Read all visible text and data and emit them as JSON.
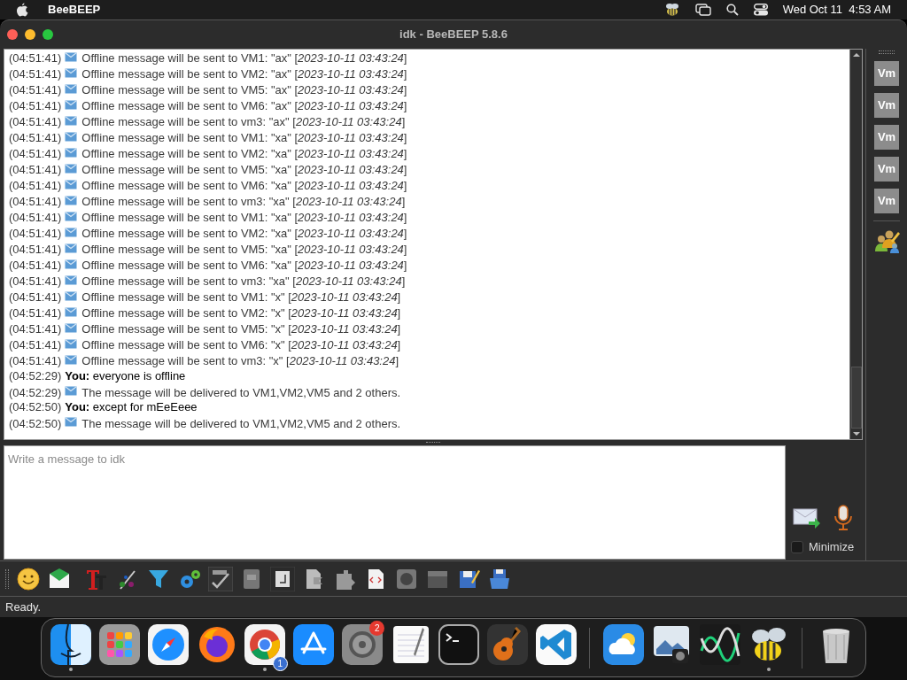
{
  "menu_bar": {
    "app_name": "BeeBEEP",
    "clock": "Wed Oct 11  4:53 AM"
  },
  "window": {
    "title": "idk - BeeBEEP 5.8.6"
  },
  "messages": [
    {
      "kind": "offline",
      "time": "(04:51:41)",
      "text": "Offline message will be sent to VM1: \"ax\" [*2023-10-11 03:43:24*]"
    },
    {
      "kind": "offline",
      "time": "(04:51:41)",
      "text": "Offline message will be sent to VM2: \"ax\" [*2023-10-11 03:43:24*]"
    },
    {
      "kind": "offline",
      "time": "(04:51:41)",
      "text": "Offline message will be sent to VM5: \"ax\" [*2023-10-11 03:43:24*]"
    },
    {
      "kind": "offline",
      "time": "(04:51:41)",
      "text": "Offline message will be sent to VM6: \"ax\" [*2023-10-11 03:43:24*]"
    },
    {
      "kind": "offline",
      "time": "(04:51:41)",
      "text": "Offline message will be sent to vm3: \"ax\" [*2023-10-11 03:43:24*]"
    },
    {
      "kind": "offline",
      "time": "(04:51:41)",
      "text": "Offline message will be sent to VM1: \"xa\" [*2023-10-11 03:43:24*]"
    },
    {
      "kind": "offline",
      "time": "(04:51:41)",
      "text": "Offline message will be sent to VM2: \"xa\" [*2023-10-11 03:43:24*]"
    },
    {
      "kind": "offline",
      "time": "(04:51:41)",
      "text": "Offline message will be sent to VM5: \"xa\" [*2023-10-11 03:43:24*]"
    },
    {
      "kind": "offline",
      "time": "(04:51:41)",
      "text": "Offline message will be sent to VM6: \"xa\" [*2023-10-11 03:43:24*]"
    },
    {
      "kind": "offline",
      "time": "(04:51:41)",
      "text": "Offline message will be sent to vm3: \"xa\" [*2023-10-11 03:43:24*]"
    },
    {
      "kind": "offline",
      "time": "(04:51:41)",
      "text": "Offline message will be sent to VM1: \"xa\" [*2023-10-11 03:43:24*]"
    },
    {
      "kind": "offline",
      "time": "(04:51:41)",
      "text": "Offline message will be sent to VM2: \"xa\" [*2023-10-11 03:43:24*]"
    },
    {
      "kind": "offline",
      "time": "(04:51:41)",
      "text": "Offline message will be sent to VM5: \"xa\" [*2023-10-11 03:43:24*]"
    },
    {
      "kind": "offline",
      "time": "(04:51:41)",
      "text": "Offline message will be sent to VM6: \"xa\" [*2023-10-11 03:43:24*]"
    },
    {
      "kind": "offline",
      "time": "(04:51:41)",
      "text": "Offline message will be sent to vm3: \"xa\" [*2023-10-11 03:43:24*]"
    },
    {
      "kind": "offline",
      "time": "(04:51:41)",
      "text": "Offline message will be sent to VM1: \"x\" [*2023-10-11 03:43:24*]"
    },
    {
      "kind": "offline",
      "time": "(04:51:41)",
      "text": "Offline message will be sent to VM2: \"x\" [*2023-10-11 03:43:24*]"
    },
    {
      "kind": "offline",
      "time": "(04:51:41)",
      "text": "Offline message will be sent to VM5: \"x\" [*2023-10-11 03:43:24*]"
    },
    {
      "kind": "offline",
      "time": "(04:51:41)",
      "text": "Offline message will be sent to VM6: \"x\" [*2023-10-11 03:43:24*]"
    },
    {
      "kind": "offline",
      "time": "(04:51:41)",
      "text": "Offline message will be sent to vm3: \"x\" [*2023-10-11 03:43:24*]"
    },
    {
      "kind": "chat",
      "time": "(04:52:29)",
      "text": "**You:** everyone is offline"
    },
    {
      "kind": "system",
      "time": "(04:52:29)",
      "text": "The message will be delivered to VM1,VM2,VM5 and 2 others."
    },
    {
      "kind": "chat",
      "time": "(04:52:50)",
      "text": "**You:** except for mEeEeee"
    },
    {
      "kind": "system",
      "time": "(04:52:50)",
      "text": "The message will be delivered to VM1,VM2,VM5 and 2 others."
    }
  ],
  "composer": {
    "placeholder": "Write a message to idk",
    "minimize": {
      "label": "Minimize",
      "checked": false
    }
  },
  "members": [
    {
      "initials": "Vm"
    },
    {
      "initials": "Vm"
    },
    {
      "initials": "Vm"
    },
    {
      "initials": "Vm"
    },
    {
      "initials": "Vm"
    }
  ],
  "status_bar": "Ready.",
  "dock": {
    "groups": [
      [
        {
          "kind": "finder",
          "running": true
        },
        {
          "kind": "launchpad",
          "running": false
        },
        {
          "kind": "safari",
          "running": false
        },
        {
          "kind": "firefox",
          "running": false
        },
        {
          "kind": "chrome",
          "running": true,
          "badge": "1"
        },
        {
          "kind": "appstore",
          "running": false
        },
        {
          "kind": "settings",
          "running": false,
          "badge": "2"
        },
        {
          "kind": "textedit",
          "running": false
        },
        {
          "kind": "terminal",
          "running": false
        },
        {
          "kind": "guitar",
          "running": false
        },
        {
          "kind": "vscode",
          "running": false
        }
      ],
      [
        {
          "kind": "weather",
          "running": false
        },
        {
          "kind": "preview",
          "running": false
        },
        {
          "kind": "wave",
          "running": false
        },
        {
          "kind": "bee",
          "running": true
        }
      ],
      [
        {
          "kind": "trash",
          "running": false
        }
      ]
    ]
  }
}
